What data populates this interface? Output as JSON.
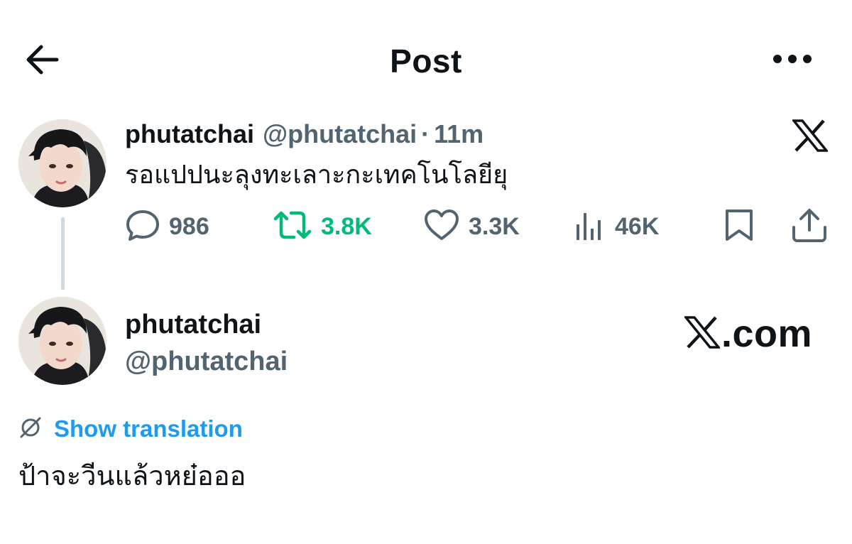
{
  "header": {
    "title": "Post",
    "back_icon": "arrow-left-icon",
    "more_icon": "more-horizontal-icon"
  },
  "post": {
    "display_name": "phutatchai",
    "handle": "@phutatchai",
    "separator": "·",
    "time": "11m",
    "text": "รอแปปนะลุงทะเลาะกะเทคโนโลยียุ",
    "platform_icon": "x-logo-icon",
    "actions": {
      "replies": "986",
      "reposts": "3.8K",
      "likes": "3.3K",
      "views": "46K"
    }
  },
  "embed": {
    "display_name": "phutatchai",
    "handle": "@phutatchai",
    "brand_text": ".com",
    "translate_label": "Show translation",
    "text": "ป้าจะวีนแล้วหย๋อออ"
  },
  "colors": {
    "text_primary": "#0f1419",
    "text_secondary": "#536471",
    "repost_green": "#00ba7c",
    "link_blue": "#1d9bf0",
    "thread_line": "#cfd9de"
  }
}
